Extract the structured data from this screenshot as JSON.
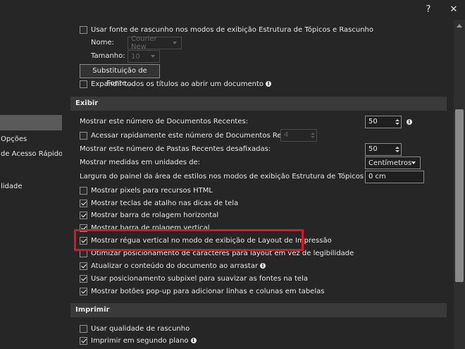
{
  "window": {
    "help_label": "?",
    "close_label": "✕"
  },
  "sidebar": {
    "items": [
      {
        "label": "",
        "selected": true
      },
      {
        "label": "Opções"
      },
      {
        "label": "de Acesso Rápido"
      },
      {
        "label": "lidade"
      }
    ]
  },
  "content": {
    "draft_font": {
      "checkbox_label": "Usar fonte de rascunho nos modos de exibição Estrutura de Tópicos e Rascunho",
      "name_label": "Nome:",
      "name_value": "Courier New",
      "size_label": "Tamanho:",
      "size_value": "10",
      "substitution_button": "Substituição de Fonte...",
      "expand_titles_label": "Expandir todos os títulos ao abrir um documento"
    },
    "exibir": {
      "header": "Exibir",
      "recent_docs_label": "Mostrar este número de Documentos Recentes:",
      "recent_docs_value": "50",
      "quick_access_label": "Acessar rapidamente este número de Documentos Recentes:",
      "quick_access_value": "4",
      "recent_folders_label": "Mostrar este número de Pastas Recentes desafixadas:",
      "recent_folders_value": "50",
      "units_label": "Mostrar medidas em unidades de:",
      "units_value": "Centímetros",
      "style_pane_label": "Largura do painel da área de estilos nos modos de exibição Estrutura de Tópicos e Rascunho:",
      "style_pane_value": "0 cm",
      "options": [
        {
          "label": "Mostrar pixels para recursos HTML",
          "checked": false
        },
        {
          "label": "Mostrar teclas de atalho nas dicas de tela",
          "checked": true
        },
        {
          "label": "Mostrar barra de rolagem horizontal",
          "checked": true
        },
        {
          "label": "Mostrar barra de rolagem vertical",
          "checked": true
        },
        {
          "label": "Mostrar régua vertical no modo de exibição de Layout de Impressão",
          "checked": true
        },
        {
          "label": "Otimizar posicionamento de caracteres para layout em vez de legibilidade",
          "checked": false
        },
        {
          "label": "Atualizar o conteúdo do documento ao arrastar",
          "checked": true
        },
        {
          "label": "Usar posicionamento subpixel para suavizar as fontes na tela",
          "checked": true
        },
        {
          "label": "Mostrar botões pop-up para adicionar linhas e colunas em tabelas",
          "checked": true
        }
      ]
    },
    "imprimir": {
      "header": "Imprimir",
      "options": [
        {
          "label": "Usar qualidade de rascunho",
          "checked": false
        },
        {
          "label": "Imprimir em segundo plano",
          "checked": true
        }
      ]
    }
  },
  "colors": {
    "background": "#262626",
    "section_header": "#3a3a3a",
    "highlight_border": "#e0141a",
    "sidebar_selected": "#5a5a5a"
  },
  "scrollbar": {
    "position": 0.55
  }
}
